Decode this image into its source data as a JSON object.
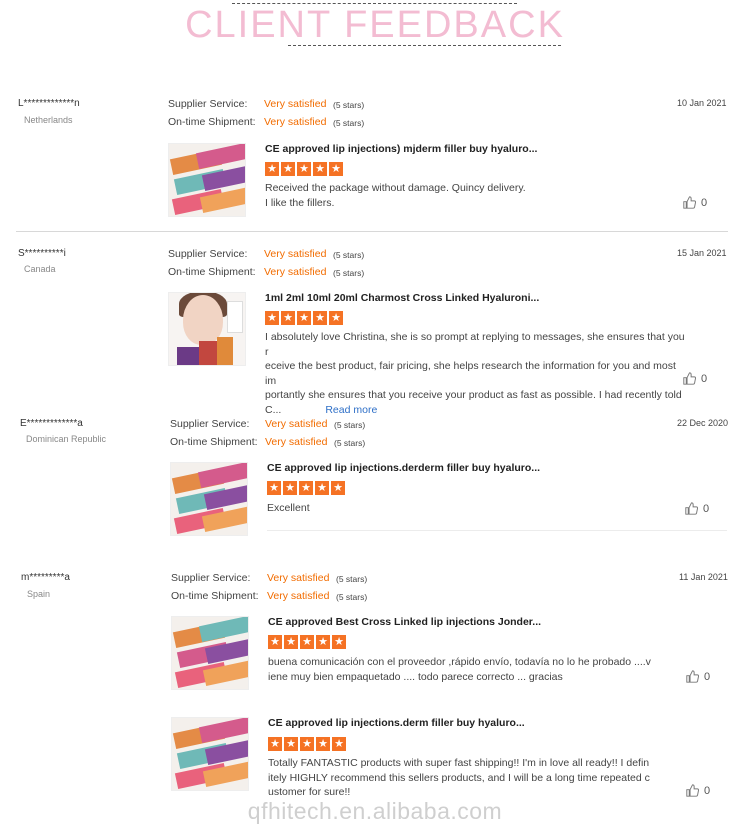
{
  "header": {
    "title": "CLIENT  FEEDBACK"
  },
  "labels": {
    "supplier_service": "Supplier Service:",
    "on_time_shipment": "On-time Shipment:",
    "read_more": "Read more"
  },
  "colors": {
    "title_pink": "#f3bcd2",
    "accent_orange": "#f26c00",
    "star_orange": "#f57224",
    "link_blue": "#2e6fc7"
  },
  "reviews": [
    {
      "user": "L*************n",
      "country": "Netherlands",
      "date": "10 Jan 2021",
      "supplier_value": "Very satisfied",
      "supplier_stars": "(5 stars)",
      "shipment_value": "Very satisfied",
      "shipment_stars": "(5 stars)",
      "items": [
        {
          "product": "CE approved lip injections)  mjderm filler buy hyaluro...",
          "rating": 5,
          "comment": [
            "Received the package without damage. Quincy delivery.",
            "I like the fillers."
          ],
          "likes": "0"
        }
      ]
    },
    {
      "user": "S**********i",
      "country": "Canada",
      "date": "15 Jan 2021",
      "supplier_value": "Very satisfied",
      "supplier_stars": "(5 stars)",
      "shipment_value": "Very satisfied",
      "shipment_stars": "(5 stars)",
      "items": [
        {
          "product": "1ml 2ml 10ml 20ml Charmost Cross Linked Hyaluroni...",
          "rating": 5,
          "comment": [
            "I absolutely love Christina, she is so prompt at replying to messages, she ensures that you r",
            "eceive the best product, fair pricing, she helps research the information for you and most im",
            "portantly she ensures that you receive your product as fast as possible. I had recently told",
            "C..."
          ],
          "likes": "0"
        }
      ]
    },
    {
      "user": "E*************a",
      "country": "Dominican Republic",
      "date": "22 Dec 2020",
      "supplier_value": "Very satisfied",
      "supplier_stars": "(5 stars)",
      "shipment_value": "Very satisfied",
      "shipment_stars": "(5 stars)",
      "items": [
        {
          "product": "CE approved lip injections.derderm filler buy hyaluro...",
          "rating": 5,
          "comment": [
            "Excellent"
          ],
          "likes": "0"
        }
      ]
    },
    {
      "user": "m*********a",
      "country": "Spain",
      "date": "11 Jan 2021",
      "supplier_value": "Very satisfied",
      "supplier_stars": "(5 stars)",
      "shipment_value": "Very satisfied",
      "shipment_stars": "(5 stars)",
      "items": [
        {
          "product": "CE approved Best Cross Linked lip injections Jonder...",
          "rating": 5,
          "comment": [
            "buena comunicación con el proveedor ,rápido envío, todavía no lo he probado ....v",
            "iene muy bien empaquetado .... todo parece correcto ... gracias"
          ],
          "likes": "0"
        },
        {
          "product": "CE approved lip injections.derm filler buy hyaluro...",
          "rating": 5,
          "comment": [
            "Totally FANTASTIC products with super fast shipping!! I'm in love all ready!! I defin",
            "itely HIGHLY recommend this sellers products, and I will be a long time repeated c",
            "ustomer for sure!!"
          ],
          "likes": "0"
        }
      ]
    }
  ],
  "watermark": "qfhitech.en.alibaba.com"
}
